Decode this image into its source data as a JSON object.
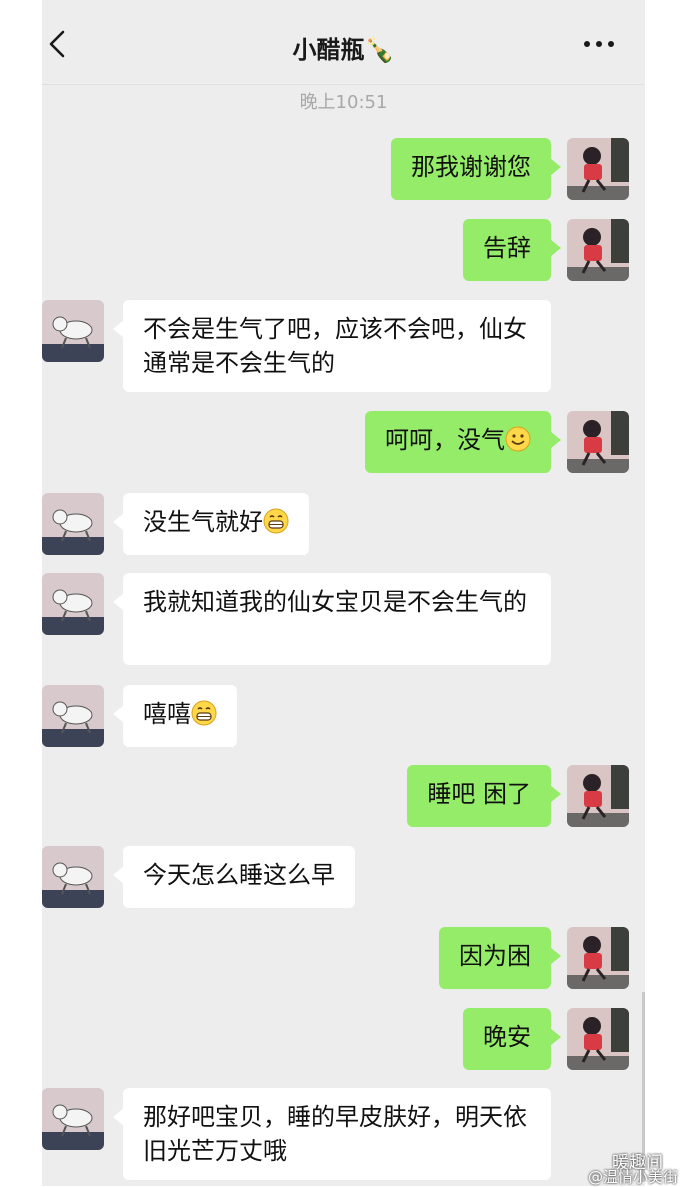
{
  "header": {
    "title": "小醋瓶🍾",
    "back_icon": "chevron-left-icon",
    "more_icon": "more-dots-icon"
  },
  "timestamp": "晚上10:51",
  "messages": [
    {
      "side": "me",
      "text": "那我谢谢您"
    },
    {
      "side": "me",
      "text": "告辞"
    },
    {
      "side": "them",
      "text": "不会是生气了吧，应该不会吧，仙女通常是不会生气的"
    },
    {
      "side": "me",
      "text": "呵呵，没气",
      "emoji": "smile"
    },
    {
      "side": "them",
      "text": "没生气就好",
      "emoji": "grin"
    },
    {
      "side": "them",
      "text": "我就知道我的仙女宝贝是不会生气的"
    },
    {
      "side": "them",
      "text": "嘻嘻",
      "emoji": "grin"
    },
    {
      "side": "me",
      "text": "睡吧 困了"
    },
    {
      "side": "them",
      "text": "今天怎么睡这么早"
    },
    {
      "side": "me",
      "text": "因为困"
    },
    {
      "side": "me",
      "text": "晚安"
    },
    {
      "side": "them",
      "text": "那好吧宝贝，睡的早皮肤好，明天依旧光芒万丈哦"
    }
  ],
  "watermark": {
    "line1": "暖趣间",
    "line2": "@温情小美街"
  },
  "colors": {
    "background": "#ededed",
    "my_bubble": "#95ec69",
    "their_bubble": "#ffffff"
  }
}
